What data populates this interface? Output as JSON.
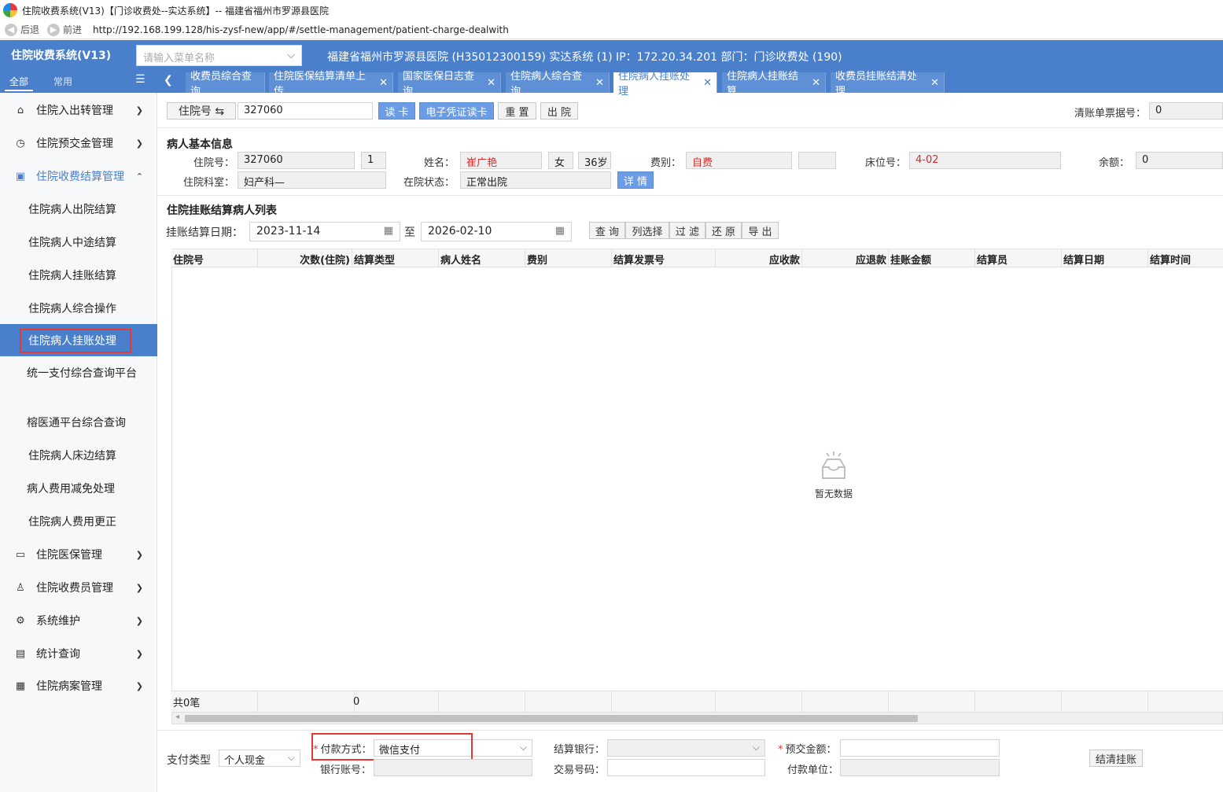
{
  "window": {
    "title": "住院收费系统(V13)【门诊收费处--实达系统】-- 福建省福州市罗源县医院",
    "back_label": "后退",
    "forward_label": "前进",
    "url": "http://192.168.199.128/his-zysf-new/app/#/settle-management/patient-charge-dealwith"
  },
  "header": {
    "system_title": "住院收费系统(V13)",
    "menu_search_placeholder": "请输入菜单名称",
    "hospital_info": "福建省福州市罗源县医院 (H35012300159) 实达系统 (1) IP：172.20.34.201 部门：门诊收费处 (190)"
  },
  "sidebar": {
    "tab_all": "全部",
    "tab_common": "常用",
    "groups": [
      {
        "label": "住院入出转管理",
        "icon": "building-icon"
      },
      {
        "label": "住院预交金管理",
        "icon": "clock-icon"
      },
      {
        "label": "住院收费结算管理",
        "icon": "receipt-icon"
      },
      {
        "label": "住院医保管理",
        "icon": "card-icon"
      },
      {
        "label": "住院收费员管理",
        "icon": "user-icon"
      },
      {
        "label": "系统维护",
        "icon": "gear-icon"
      },
      {
        "label": "统计查询",
        "icon": "chart-icon"
      },
      {
        "label": "住院病案管理",
        "icon": "file-icon"
      }
    ],
    "sub_items": [
      "住院病人出院结算",
      "住院病人中途结算",
      "住院病人挂账结算",
      "住院病人综合操作",
      "住院病人挂账处理",
      "统一支付综合查询平台",
      "榕医通平台综合查询",
      "住院病人床边结算",
      "病人费用减免处理",
      "住院病人费用更正"
    ]
  },
  "tabs": [
    {
      "label": "收费员综合查询",
      "closable": false
    },
    {
      "label": "住院医保结算清单上传",
      "closable": true
    },
    {
      "label": "国家医保日志查询",
      "closable": true
    },
    {
      "label": "住院病人综合查询",
      "closable": true
    },
    {
      "label": "住院病人挂账处理",
      "closable": true
    },
    {
      "label": "住院病人挂账结算",
      "closable": true
    },
    {
      "label": "收费员挂账结清处理",
      "closable": true
    }
  ],
  "toolbar": {
    "inpatient_no_label": "住院号 ⇆",
    "inpatient_no_value": "327060",
    "read_card": "读 卡",
    "e_voucher_read": "电子凭证读卡",
    "reset": "重 置",
    "discharge": "出 院",
    "clear_receipt_label": "清账单票据号：",
    "clear_receipt_value": "0"
  },
  "patient": {
    "section_title": "病人基本信息",
    "inpatient_no_label": "住院号：",
    "inpatient_no": "327060",
    "times": "1",
    "name_label": "姓名：",
    "name": "崔广艳",
    "gender": "女",
    "age": "36岁",
    "fee_type_label": "费别：",
    "fee_type": "自费",
    "fee_extra": "",
    "bed_label": "床位号：",
    "bed": "4-02",
    "balance_label": "余额：",
    "balance": "0",
    "dept_label": "住院科室：",
    "dept": "妇产科—",
    "status_label": "在院状态：",
    "status": "正常出院",
    "detail_button": "详 情"
  },
  "list": {
    "section_title": "住院挂账结算病人列表",
    "date_label": "挂账结算日期：",
    "date_from": "2023-11-14",
    "date_to_sep": "至",
    "date_to": "2026-02-10",
    "buttons": [
      "查 询",
      "列选择",
      "过 滤",
      "还 原",
      "导 出"
    ],
    "columns": [
      "住院号",
      "次数(住院)",
      "结算类型",
      "病人姓名",
      "费别",
      "结算发票号",
      "应收款",
      "应退款",
      "挂账金额",
      "结算员",
      "结算日期",
      "结算时间"
    ],
    "empty_text": "暂无数据",
    "footer_count": "共0笔",
    "footer_value": "0"
  },
  "payment": {
    "pay_type_label": "支付类型",
    "pay_type_value": "个人现金",
    "pay_method_label": "付款方式：",
    "pay_method_value": "微信支付",
    "bank_account_label": "银行账号：",
    "bank_account_value": "",
    "settle_bank_label": "结算银行：",
    "settle_bank_value": "",
    "trade_no_label": "交易号码：",
    "trade_no_value": "",
    "prepay_amount_label": "预交金额：",
    "prepay_amount_value": "",
    "pay_unit_label": "付款单位：",
    "pay_unit_value": "",
    "settle_button": "结清挂账"
  }
}
